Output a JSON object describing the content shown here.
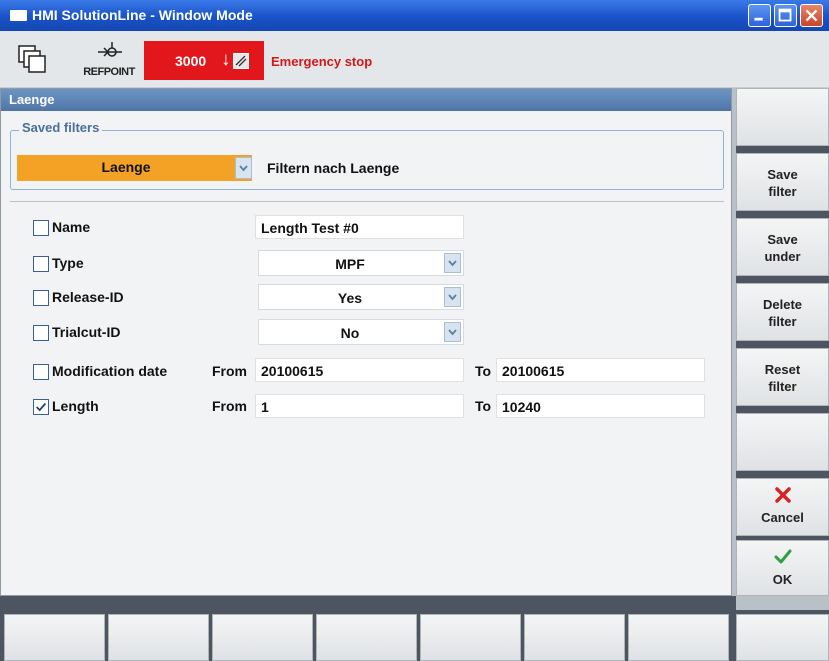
{
  "window": {
    "title": "HMI SolutionLine - Window Mode"
  },
  "header": {
    "refpoint_label": "REFPOINT",
    "alarm_number": "3000",
    "alarm_text": "Emergency stop"
  },
  "panel": {
    "title": "Laenge",
    "saved_filters_legend": "Saved filters",
    "saved_filter_selected": "Laenge",
    "saved_filter_description": "Filtern nach Laenge"
  },
  "rows": {
    "name": {
      "label": "Name",
      "checked": false,
      "value": "Length Test #0"
    },
    "type": {
      "label": "Type",
      "checked": false,
      "value": "MPF"
    },
    "release": {
      "label": "Release-ID",
      "checked": false,
      "value": "Yes"
    },
    "trialcut": {
      "label": "Trialcut-ID",
      "checked": false,
      "value": "No"
    },
    "moddate": {
      "label": "Modification date",
      "checked": false,
      "from_label": "From",
      "from_value": "20100615",
      "to_label": "To",
      "to_value": "20100615"
    },
    "length": {
      "label": "Length",
      "checked": true,
      "from_label": "From",
      "from_value": "1",
      "to_label": "To",
      "to_value": "10240"
    }
  },
  "softkeys": {
    "save_filter_1": "Save",
    "save_filter_2": "filter",
    "save_under_1": "Save",
    "save_under_2": "under",
    "delete_filter_1": "Delete",
    "delete_filter_2": "filter",
    "reset_filter_1": "Reset",
    "reset_filter_2": "filter",
    "cancel": "Cancel",
    "ok": "OK"
  },
  "colors": {
    "title_bar": "#1a52c8",
    "alarm": "#e1171b",
    "selected_filter": "#f4a226",
    "panel_header": "#5a82b4",
    "cancel_icon": "#d42424",
    "ok_icon": "#2ea043"
  },
  "icons": {
    "header_left": "window-switch-icon",
    "refpoint": "refpoint-icon",
    "cancel": "x-icon",
    "ok": "checkmark-icon"
  }
}
